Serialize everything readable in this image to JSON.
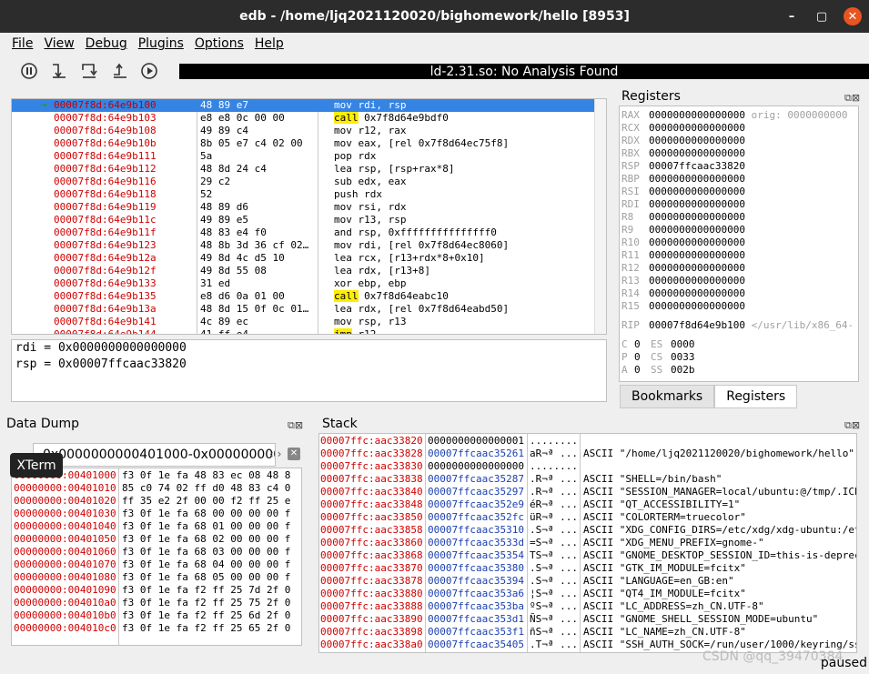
{
  "window": {
    "title": "edb - /home/ljq2021120020/bighomework/hello [8953]",
    "controls": [
      "–",
      "▢",
      "✕"
    ]
  },
  "menu": [
    "File",
    "View",
    "Debug",
    "Plugins",
    "Options",
    "Help"
  ],
  "toolbar": {
    "analysis_label": "ld-2.31.so: No Analysis Found",
    "icons": [
      "pause-icon",
      "step-into-icon",
      "step-over-icon",
      "step-out-icon",
      "run-icon"
    ]
  },
  "disassembly": [
    {
      "addr": "00007f8d:64e9b100",
      "bytes": "48 89 e7",
      "mnem": "mov",
      "ops": "rdi, rsp",
      "current": true
    },
    {
      "addr": "00007f8d:64e9b103",
      "bytes": "e8 e8 0c 00 00",
      "mnem": "call",
      "ops": "0x7f8d64e9bdf0"
    },
    {
      "addr": "00007f8d:64e9b108",
      "bytes": "49 89 c4",
      "mnem": "mov",
      "ops": "r12, rax"
    },
    {
      "addr": "00007f8d:64e9b10b",
      "bytes": "8b 05 e7 c4 02 00",
      "mnem": "mov",
      "ops": "eax, [rel 0x7f8d64ec75f8]"
    },
    {
      "addr": "00007f8d:64e9b111",
      "bytes": "5a",
      "mnem": "pop",
      "ops": "rdx"
    },
    {
      "addr": "00007f8d:64e9b112",
      "bytes": "48 8d 24 c4",
      "mnem": "lea",
      "ops": "rsp, [rsp+rax*8]"
    },
    {
      "addr": "00007f8d:64e9b116",
      "bytes": "29 c2",
      "mnem": "sub",
      "ops": "edx, eax"
    },
    {
      "addr": "00007f8d:64e9b118",
      "bytes": "52",
      "mnem": "push",
      "ops": "rdx"
    },
    {
      "addr": "00007f8d:64e9b119",
      "bytes": "48 89 d6",
      "mnem": "mov",
      "ops": "rsi, rdx"
    },
    {
      "addr": "00007f8d:64e9b11c",
      "bytes": "49 89 e5",
      "mnem": "mov",
      "ops": "r13, rsp"
    },
    {
      "addr": "00007f8d:64e9b11f",
      "bytes": "48 83 e4 f0",
      "mnem": "and",
      "ops": "rsp, 0xfffffffffffffff0"
    },
    {
      "addr": "00007f8d:64e9b123",
      "bytes": "48 8b 3d 36 cf 02…",
      "mnem": "mov",
      "ops": "rdi, [rel 0x7f8d64ec8060]"
    },
    {
      "addr": "00007f8d:64e9b12a",
      "bytes": "49 8d 4c d5 10",
      "mnem": "lea",
      "ops": "rcx, [r13+rdx*8+0x10]"
    },
    {
      "addr": "00007f8d:64e9b12f",
      "bytes": "49 8d 55 08",
      "mnem": "lea",
      "ops": "rdx, [r13+8]"
    },
    {
      "addr": "00007f8d:64e9b133",
      "bytes": "31 ed",
      "mnem": "xor",
      "ops": "ebp, ebp"
    },
    {
      "addr": "00007f8d:64e9b135",
      "bytes": "e8 d6 0a 01 00",
      "mnem": "call",
      "ops": "0x7f8d64eabc10"
    },
    {
      "addr": "00007f8d:64e9b13a",
      "bytes": "48 8d 15 0f 0c 01…",
      "mnem": "lea",
      "ops": "rdx, [rel 0x7f8d64eabd50]"
    },
    {
      "addr": "00007f8d:64e9b141",
      "bytes": "4c 89 ec",
      "mnem": "mov",
      "ops": "rsp, r13"
    },
    {
      "addr": "00007f8d:64e9b144",
      "bytes": "41 ff e4",
      "mnem": "jmp",
      "ops": "r12"
    }
  ],
  "reg_info": [
    "rdi = 0x0000000000000000",
    "rsp = 0x00007ffcaac33820"
  ],
  "registers": {
    "title": "Registers",
    "gp": [
      {
        "name": "RAX",
        "value": "0000000000000000",
        "extra": "orig: 0000000000"
      },
      {
        "name": "RCX",
        "value": "0000000000000000"
      },
      {
        "name": "RDX",
        "value": "0000000000000000"
      },
      {
        "name": "RBX",
        "value": "0000000000000000"
      },
      {
        "name": "RSP",
        "value": "00007ffcaac33820"
      },
      {
        "name": "RBP",
        "value": "0000000000000000"
      },
      {
        "name": "RSI",
        "value": "0000000000000000"
      },
      {
        "name": "RDI",
        "value": "0000000000000000"
      },
      {
        "name": "R8",
        "value": "0000000000000000"
      },
      {
        "name": "R9",
        "value": "0000000000000000"
      },
      {
        "name": "R10",
        "value": "0000000000000000"
      },
      {
        "name": "R11",
        "value": "0000000000000000"
      },
      {
        "name": "R12",
        "value": "0000000000000000"
      },
      {
        "name": "R13",
        "value": "0000000000000000"
      },
      {
        "name": "R14",
        "value": "0000000000000000"
      },
      {
        "name": "R15",
        "value": "0000000000000000"
      }
    ],
    "rip": {
      "name": "RIP",
      "value": "00007f8d64e9b100",
      "extra": "</usr/lib/x86_64-"
    },
    "flags": [
      {
        "flag": "C",
        "fv": "0",
        "seg": "ES",
        "sv": "0000"
      },
      {
        "flag": "P",
        "fv": "0",
        "seg": "CS",
        "sv": "0033"
      },
      {
        "flag": "A",
        "fv": "0",
        "seg": "SS",
        "sv": "002b"
      }
    ]
  },
  "tabs": [
    "Bookmarks",
    "Registers"
  ],
  "data_dump": {
    "title": "Data Dump",
    "range": "0x0000000000401000-0x0000000000",
    "tooltip": "XTerm",
    "rows": [
      {
        "addr": "00000000:00401000",
        "bytes": "f3 0f 1e fa 48 83 ec 08 48 8"
      },
      {
        "addr": "00000000:00401010",
        "bytes": "85 c0 74 02 ff d0 48 83 c4 0"
      },
      {
        "addr": "00000000:00401020",
        "bytes": "ff 35 e2 2f 00 00 f2 ff 25 e"
      },
      {
        "addr": "00000000:00401030",
        "bytes": "f3 0f 1e fa 68 00 00 00 00 f"
      },
      {
        "addr": "00000000:00401040",
        "bytes": "f3 0f 1e fa 68 01 00 00 00 f"
      },
      {
        "addr": "00000000:00401050",
        "bytes": "f3 0f 1e fa 68 02 00 00 00 f"
      },
      {
        "addr": "00000000:00401060",
        "bytes": "f3 0f 1e fa 68 03 00 00 00 f"
      },
      {
        "addr": "00000000:00401070",
        "bytes": "f3 0f 1e fa 68 04 00 00 00 f"
      },
      {
        "addr": "00000000:00401080",
        "bytes": "f3 0f 1e fa 68 05 00 00 00 f"
      },
      {
        "addr": "00000000:00401090",
        "bytes": "f3 0f 1e fa f2 ff 25 7d 2f 0"
      },
      {
        "addr": "00000000:004010a0",
        "bytes": "f3 0f 1e fa f2 ff 25 75 2f 0"
      },
      {
        "addr": "00000000:004010b0",
        "bytes": "f3 0f 1e fa f2 ff 25 6d 2f 0"
      },
      {
        "addr": "00000000:004010c0",
        "bytes": "f3 0f 1e fa f2 ff 25 65 2f 0"
      }
    ]
  },
  "stack": {
    "title": "Stack",
    "rows": [
      {
        "addr": "00007ffc:aac33820",
        "value": "0000000000000001",
        "ascii": "........",
        "comment": ""
      },
      {
        "addr": "00007ffc:aac33828",
        "value": "00007ffcaac35261",
        "ascii": "aR¬ª ...",
        "comment": "ASCII \"/home/ljq2021120020/bighomework/hello\""
      },
      {
        "addr": "00007ffc:aac33830",
        "value": "0000000000000000",
        "ascii": "........",
        "comment": ""
      },
      {
        "addr": "00007ffc:aac33838",
        "value": "00007ffcaac35287",
        "ascii": ".R¬ª ...",
        "comment": "ASCII \"SHELL=/bin/bash\""
      },
      {
        "addr": "00007ffc:aac33840",
        "value": "00007ffcaac35297",
        "ascii": ".R¬ª ...",
        "comment": "ASCII \"SESSION_MANAGER=local/ubuntu:@/tmp/.ICE"
      },
      {
        "addr": "00007ffc:aac33848",
        "value": "00007ffcaac352e9",
        "ascii": "éR¬ª ...",
        "comment": "ASCII \"QT_ACCESSIBILITY=1\""
      },
      {
        "addr": "00007ffc:aac33850",
        "value": "00007ffcaac352fc",
        "ascii": "üR¬ª ...",
        "comment": "ASCII \"COLORTERM=truecolor\""
      },
      {
        "addr": "00007ffc:aac33858",
        "value": "00007ffcaac35310",
        "ascii": ".S¬ª ...",
        "comment": "ASCII \"XDG_CONFIG_DIRS=/etc/xdg/xdg-ubuntu:/et"
      },
      {
        "addr": "00007ffc:aac33860",
        "value": "00007ffcaac3533d",
        "ascii": "=S¬ª ...",
        "comment": "ASCII \"XDG_MENU_PREFIX=gnome-\""
      },
      {
        "addr": "00007ffc:aac33868",
        "value": "00007ffcaac35354",
        "ascii": "TS¬ª ...",
        "comment": "ASCII \"GNOME_DESKTOP_SESSION_ID=this-is-deprec"
      },
      {
        "addr": "00007ffc:aac33870",
        "value": "00007ffcaac35380",
        "ascii": ".S¬ª ...",
        "comment": "ASCII \"GTK_IM_MODULE=fcitx\""
      },
      {
        "addr": "00007ffc:aac33878",
        "value": "00007ffcaac35394",
        "ascii": ".S¬ª ...",
        "comment": "ASCII \"LANGUAGE=en_GB:en\""
      },
      {
        "addr": "00007ffc:aac33880",
        "value": "00007ffcaac353a6",
        "ascii": "¦S¬ª ...",
        "comment": "ASCII \"QT4_IM_MODULE=fcitx\""
      },
      {
        "addr": "00007ffc:aac33888",
        "value": "00007ffcaac353ba",
        "ascii": "ºS¬ª ...",
        "comment": "ASCII \"LC_ADDRESS=zh_CN.UTF-8\""
      },
      {
        "addr": "00007ffc:aac33890",
        "value": "00007ffcaac353d1",
        "ascii": "ÑS¬ª ...",
        "comment": "ASCII \"GNOME_SHELL_SESSION_MODE=ubuntu\""
      },
      {
        "addr": "00007ffc:aac33898",
        "value": "00007ffcaac353f1",
        "ascii": "ñS¬ª ...",
        "comment": "ASCII \"LC_NAME=zh_CN.UTF-8\""
      },
      {
        "addr": "00007ffc:aac338a0",
        "value": "00007ffcaac35405",
        "ascii": ".T¬ª ...",
        "comment": "ASCII \"SSH_AUTH_SOCK=/run/user/1000/keyring/ss"
      }
    ]
  },
  "status": "paused",
  "watermark": "CSDN @qq_39470384"
}
